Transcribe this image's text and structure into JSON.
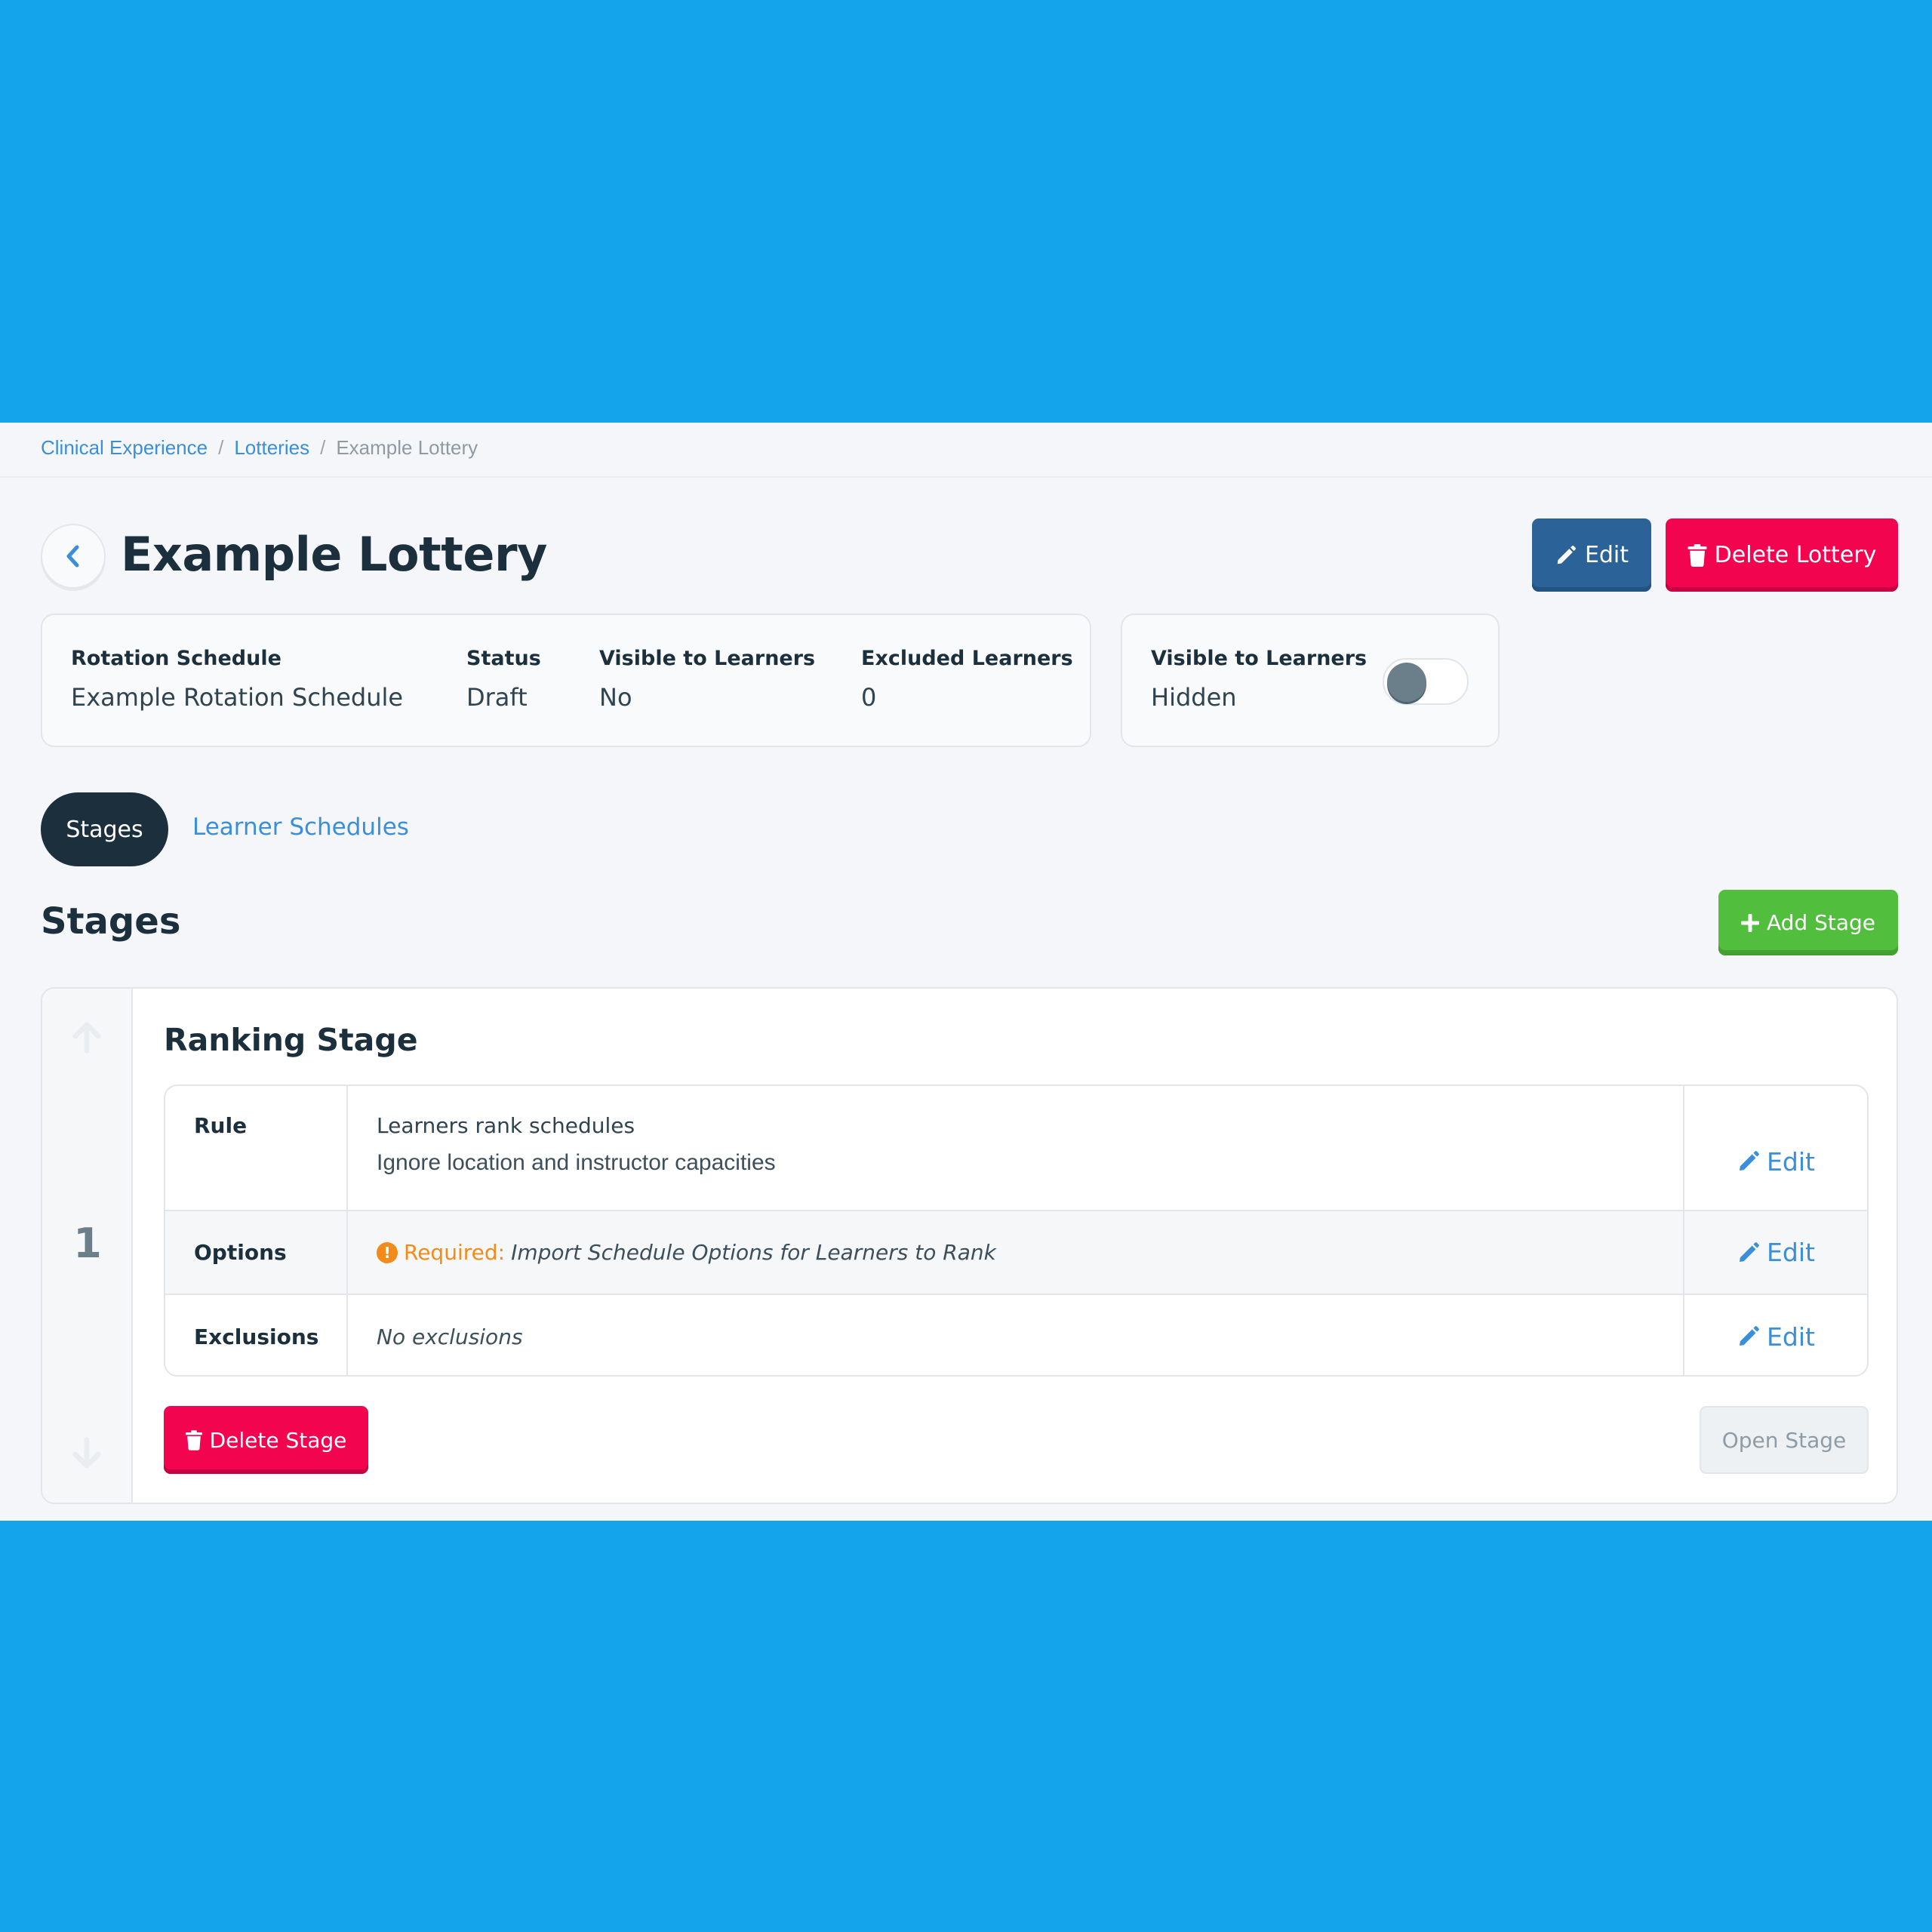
{
  "breadcrumb": {
    "items": [
      "Clinical Experience",
      "Lotteries"
    ],
    "current": "Example Lottery",
    "separator": "/"
  },
  "header": {
    "title": "Example Lottery",
    "edit_label": "Edit",
    "delete_label": "Delete Lottery"
  },
  "info": {
    "rotation_schedule_label": "Rotation Schedule",
    "rotation_schedule_value": "Example Rotation Schedule",
    "status_label": "Status",
    "status_value": "Draft",
    "visible_label": "Visible to Learners",
    "visible_value": "No",
    "excluded_label": "Excluded Learners",
    "excluded_value": "0"
  },
  "visibility_card": {
    "label": "Visible to Learners",
    "value": "Hidden",
    "toggle_on": false
  },
  "tabs": [
    {
      "label": "Stages",
      "active": true
    },
    {
      "label": "Learner Schedules",
      "active": false
    }
  ],
  "section": {
    "title": "Stages",
    "add_label": "Add Stage"
  },
  "stage": {
    "number": "1",
    "title": "Ranking Stage",
    "rows": [
      {
        "label": "Rule",
        "line1": "Learners rank schedules",
        "line2": "Ignore location and instructor capacities",
        "edit": "Edit"
      },
      {
        "label": "Options",
        "required_label": "Required:",
        "value": "Import Schedule Options for Learners to Rank",
        "edit": "Edit"
      },
      {
        "label": "Exclusions",
        "value": "No exclusions",
        "edit": "Edit"
      }
    ],
    "delete_label": "Delete Stage",
    "open_label": "Open Stage"
  },
  "colors": {
    "background": "#13a4ec",
    "primary": "#2b6398",
    "danger": "#f2044f",
    "success": "#52be3d",
    "link": "#3a8fd8",
    "warning": "#f38b1a",
    "dark": "#1c2f3d"
  }
}
